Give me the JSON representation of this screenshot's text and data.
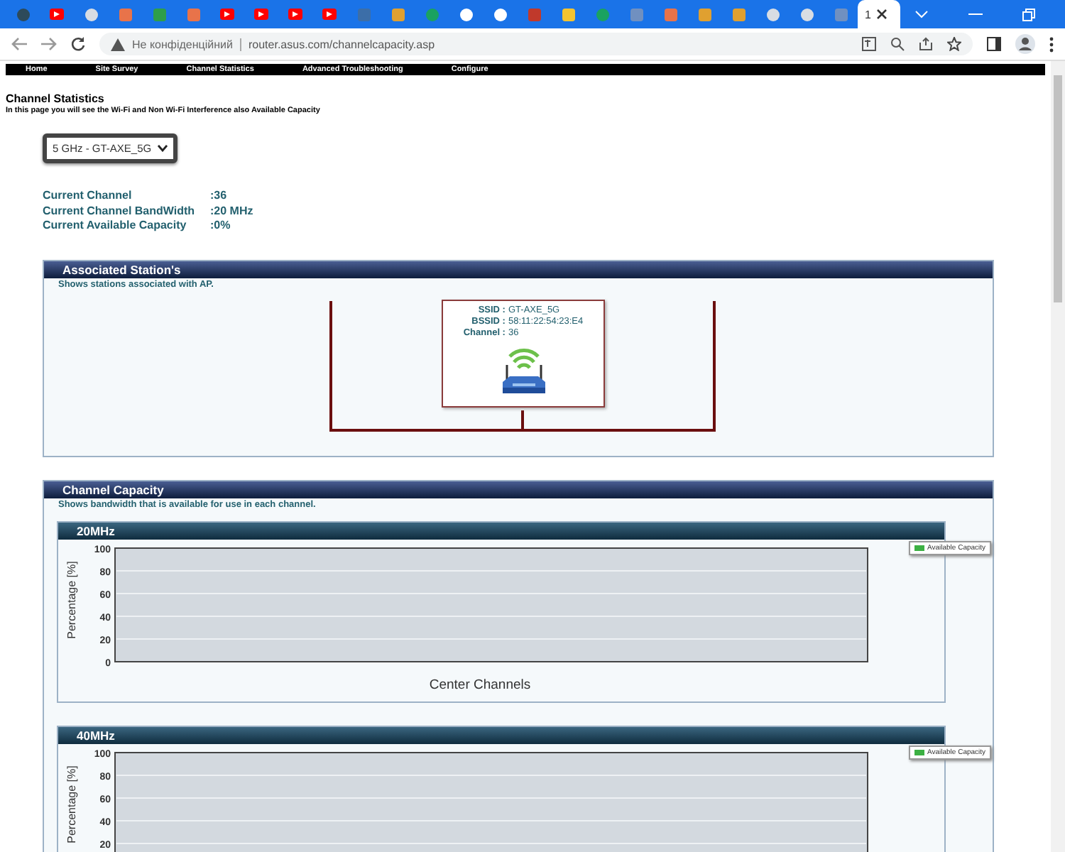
{
  "browser": {
    "tabs": [
      {
        "kind": "globe",
        "selected": false
      },
      {
        "kind": "youtube",
        "selected": false
      },
      {
        "kind": "compass",
        "selected": false
      },
      {
        "kind": "image",
        "selected": false
      },
      {
        "kind": "leaf",
        "selected": false
      },
      {
        "kind": "image",
        "selected": false
      },
      {
        "kind": "youtube",
        "selected": false
      },
      {
        "kind": "youtube",
        "selected": false
      },
      {
        "kind": "youtube",
        "selected": false
      },
      {
        "kind": "youtube",
        "selected": false
      },
      {
        "kind": "dim",
        "selected": false
      },
      {
        "kind": "h",
        "selected": false
      },
      {
        "kind": "dot",
        "selected": false
      },
      {
        "kind": "google",
        "selected": false
      },
      {
        "kind": "google",
        "selected": false
      },
      {
        "kind": "shield",
        "selected": false
      },
      {
        "kind": "doc",
        "selected": false
      },
      {
        "kind": "dot",
        "selected": false
      },
      {
        "kind": "letter",
        "selected": false
      },
      {
        "kind": "image",
        "selected": false
      },
      {
        "kind": "h",
        "selected": false
      },
      {
        "kind": "h",
        "selected": false
      },
      {
        "kind": "compass",
        "selected": false
      },
      {
        "kind": "compass",
        "selected": false
      },
      {
        "kind": "letter",
        "selected": false
      },
      {
        "kind": "page",
        "selected": true,
        "title": "1"
      }
    ],
    "security": "Не конфіденційний",
    "url": "router.asus.com/channelcapacity.asp"
  },
  "nav": [
    "Home",
    "Site Survey",
    "Channel Statistics",
    "Advanced Troubleshooting",
    "Configure"
  ],
  "page": {
    "title": "Channel Statistics",
    "subtitle": "In this page you will see the Wi-Fi and Non Wi-Fi Interference also Available Capacity",
    "band_select": "5 GHz - GT-AXE_5G",
    "info": [
      {
        "label": "Current Channel",
        "value": ":36"
      },
      {
        "label": "Current Channel BandWidth",
        "value": ":20 MHz"
      },
      {
        "label": "Current Available Capacity",
        "value": ":0%"
      }
    ]
  },
  "stations": {
    "title": "Associated Station's",
    "description": "Shows stations associated with AP.",
    "ap": [
      {
        "label": "SSID :",
        "value": "GT-AXE_5G"
      },
      {
        "label": "BSSID :",
        "value": "58:11:22:54:23:E4"
      },
      {
        "label": "Channel :",
        "value": "36"
      }
    ]
  },
  "capacity": {
    "title": "Channel Capacity",
    "description": "Shows bandwidth that is available for use in each channel.",
    "charts": [
      {
        "title": "20MHz",
        "chart_data": {
          "type": "bar",
          "grid": true,
          "xlabel": "Center Channels",
          "ylabel": "Percentage [%]",
          "ylim": [
            0,
            100
          ],
          "yticks": [
            0,
            20,
            40,
            60,
            80,
            100
          ],
          "series": [
            {
              "name": "Available Capacity",
              "color": "#3cb043"
            }
          ]
        }
      },
      {
        "title": "40MHz",
        "chart_data": {
          "type": "bar",
          "grid": true,
          "ylabel": "Percentage [%]",
          "ylim": [
            0,
            100
          ],
          "yticks": [
            20,
            40,
            60,
            80,
            100
          ],
          "series": [
            {
              "name": "Available Capacity",
              "color": "#3cb043"
            }
          ]
        }
      }
    ]
  }
}
